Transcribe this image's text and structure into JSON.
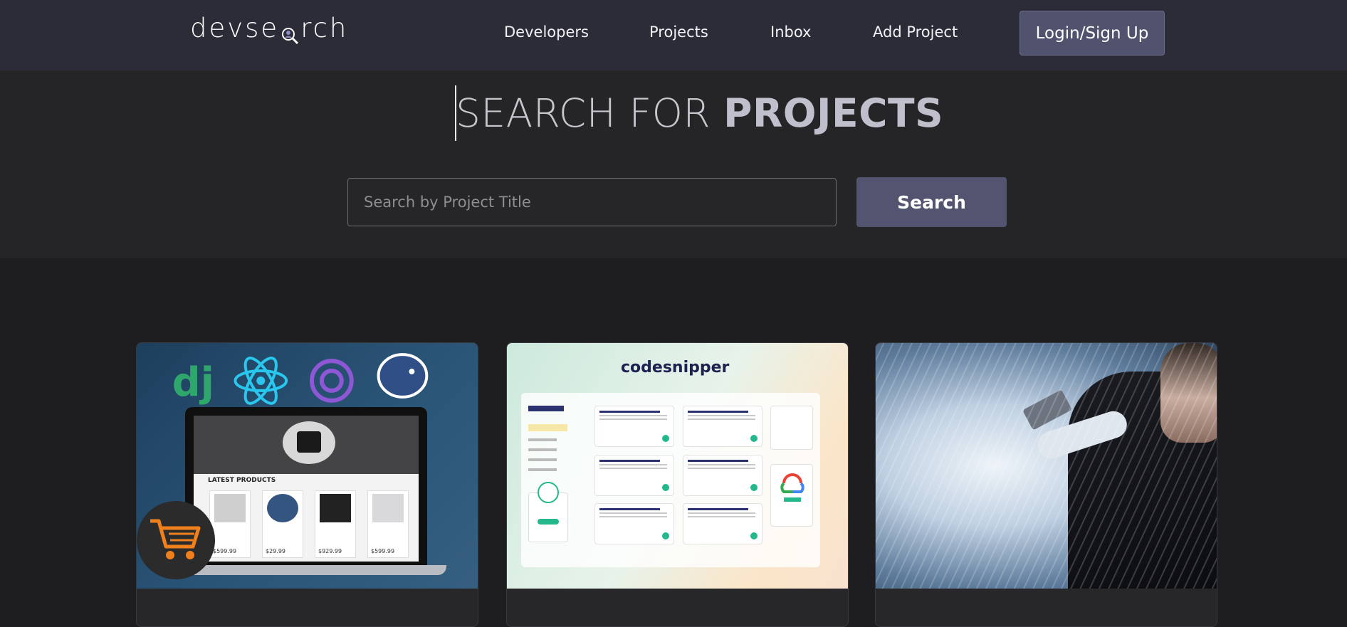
{
  "navbar": {
    "logo_text_left": "devse",
    "logo_text_right": "rch",
    "links": [
      {
        "label": "Developers"
      },
      {
        "label": "Projects"
      },
      {
        "label": "Inbox"
      },
      {
        "label": "Add Project"
      }
    ],
    "login_label": "Login/Sign Up"
  },
  "hero": {
    "title_light": "SEARCH FOR ",
    "title_bold": "PROJECTS"
  },
  "search": {
    "placeholder": "Search by Project Title",
    "value": "",
    "button_label": "Search"
  },
  "cards": [
    {
      "thumbnail": "ecommerce-django-react-thumbnail",
      "products_heading": "LATEST PRODUCTS",
      "prices": [
        "$599.99",
        "$29.99",
        "$929.99",
        "$599.99"
      ]
    },
    {
      "thumbnail": "codesnipper-thumbnail",
      "brand": "codesnipper"
    },
    {
      "thumbnail": "winter-action-poster-thumbnail"
    }
  ],
  "colors": {
    "navbar_bg": "#2c2c38",
    "hero_bg": "#252527",
    "page_bg": "#1e1e20",
    "button_bg": "#53546f"
  }
}
